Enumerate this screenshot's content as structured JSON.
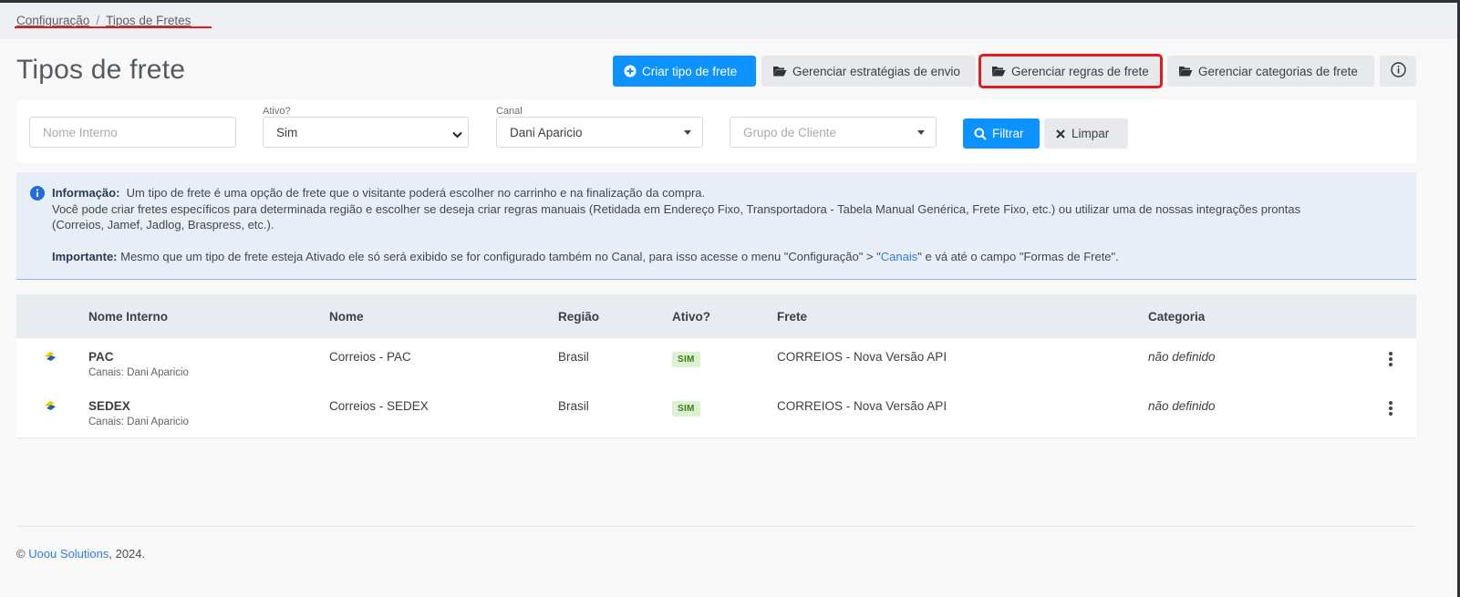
{
  "breadcrumb": {
    "items": [
      "Configuração",
      "Tipos de Fretes"
    ]
  },
  "page": {
    "title": "Tipos de frete"
  },
  "toolbar": {
    "create": "Criar tipo de frete",
    "strategies": "Gerenciar estratégias de envio",
    "rules": "Gerenciar regras de frete",
    "categories": "Gerenciar categorias de frete"
  },
  "filters": {
    "internal_name_placeholder": "Nome Interno",
    "active_label": "Ativo?",
    "active_value": "Sim",
    "channel_label": "Canal",
    "channel_value": "Dani Aparicio",
    "group_placeholder": "Grupo de Cliente",
    "filter_button": "Filtrar",
    "clear_button": "Limpar"
  },
  "info": {
    "label": "Informação:",
    "text1": "Um tipo de frete é uma opção de frete que o visitante poderá escolher no carrinho e na finalização da compra.",
    "text2": "Você pode criar fretes específicos para determinada região e escolher se deseja criar regras manuais (Retidada em Endereço Fixo, Transportadora - Tabela Manual Genérica, Frete Fixo, etc.) ou utilizar uma de nossas integrações prontas",
    "text3": "(Correios, Jamef, Jadlog, Braspress, etc.).",
    "important_label": "Importante:",
    "important_pre": "Mesmo que um tipo de frete esteja Ativado ele só será exibido se for configurado também no Canal, para isso acesse o menu \"Configuração\" > \"",
    "important_link": "Canais",
    "important_post": "\" e vá até o campo \"Formas de Frete\"."
  },
  "table": {
    "headers": [
      "Nome Interno",
      "Nome",
      "Região",
      "Ativo?",
      "Frete",
      "Categoria"
    ],
    "rows": [
      {
        "internal": "PAC",
        "channels": "Canais: Dani Aparicio",
        "name": "Correios - PAC",
        "region": "Brasil",
        "active": "SIM",
        "freight": "CORREIOS - Nova Versão API",
        "category": "não definido"
      },
      {
        "internal": "SEDEX",
        "channels": "Canais: Dani Aparicio",
        "name": "Correios - SEDEX",
        "region": "Brasil",
        "active": "SIM",
        "freight": "CORREIOS - Nova Versão API",
        "category": "não definido"
      }
    ]
  },
  "footer": {
    "prefix": "© ",
    "company": "Uoou Solutions",
    "suffix": ", 2024."
  },
  "colors": {
    "primary": "#0d93ff",
    "highlight": "#e11b1b",
    "info_bg": "#e8eef8",
    "badge_bg": "#dcf1cf"
  }
}
